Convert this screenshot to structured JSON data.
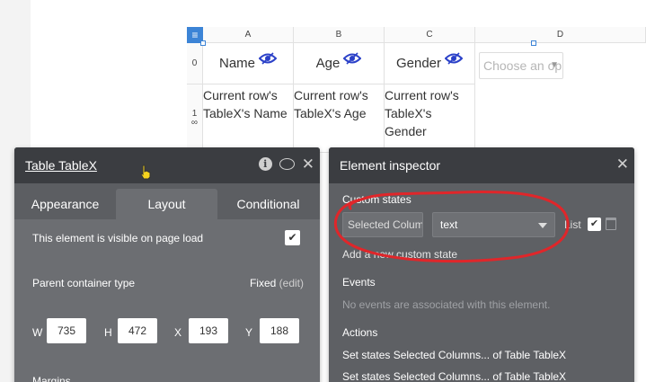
{
  "table": {
    "corner_icon": "hamburger-icon",
    "columns": [
      "A",
      "B",
      "C",
      "D"
    ],
    "rows": [
      "0",
      "1"
    ],
    "row_icon": "∞",
    "headers": [
      "Name",
      "Age",
      "Gender"
    ],
    "header_icon": "eye-icon",
    "dropdown_placeholder": "Choose an op",
    "cells": [
      "Current row's TableX's Name",
      "Current row's TableX's Age",
      "Current row's TableX's Gender"
    ]
  },
  "left_panel": {
    "title": "Table TableX",
    "tabs": [
      "Appearance",
      "Layout",
      "Conditional"
    ],
    "active_tab": "Layout",
    "visible_label": "This element is visible on page load",
    "parent_label": "Parent container type",
    "parent_value": "Fixed",
    "parent_edit": "(edit)",
    "dims": {
      "W": "735",
      "H": "472",
      "X": "193",
      "Y": "188"
    },
    "margins_label": "Margins",
    "check_glyph": "✔"
  },
  "right_panel": {
    "title": "Element inspector",
    "custom_states_label": "Custom states",
    "state_name": "Selected Colum",
    "state_type": "text",
    "list_label": "List",
    "add_state": "Add a new custom state",
    "events_label": "Events",
    "events_empty": "No events are associated with this element.",
    "actions_label": "Actions",
    "actions": [
      "Set states Selected Columns... of Table TableX",
      "Set states Selected Columns... of Table TableX"
    ]
  },
  "colors": {
    "accent": "#3c84d6",
    "panel_dark": "#3b3d41",
    "panel": "#6c6e72",
    "annotation": "#e0262a",
    "eye": "#2a40c8"
  }
}
